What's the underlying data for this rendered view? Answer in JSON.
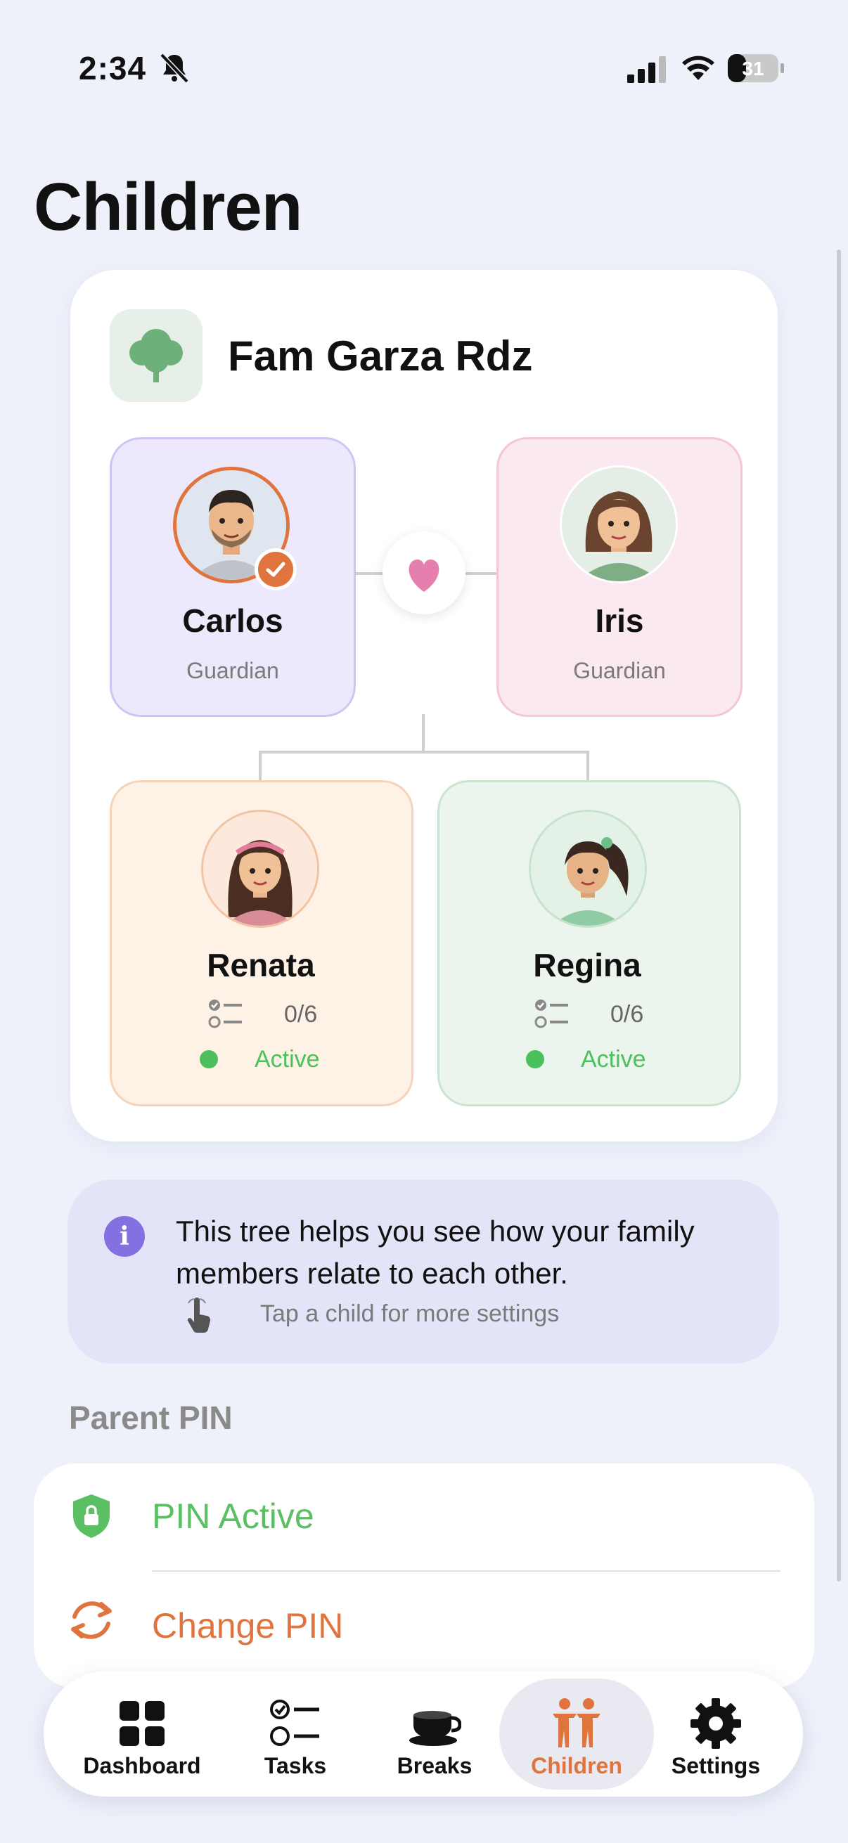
{
  "status_bar": {
    "time": "2:34",
    "battery": "31"
  },
  "page": {
    "title": "Children"
  },
  "family": {
    "name": "Fam Garza Rdz",
    "guardians": [
      {
        "name": "Carlos",
        "role": "Guardian",
        "selected": true
      },
      {
        "name": "Iris",
        "role": "Guardian"
      }
    ],
    "children": [
      {
        "name": "Renata",
        "tasks": "0/6",
        "status": "Active"
      },
      {
        "name": "Regina",
        "tasks": "0/6",
        "status": "Active"
      }
    ]
  },
  "info": {
    "text": "This tree helps you see how your family members relate to each other.",
    "hint": "Tap a child for more settings"
  },
  "parent_pin": {
    "section_label": "Parent PIN",
    "status": "PIN Active",
    "change_label": "Change PIN"
  },
  "tabbar": {
    "items": [
      {
        "label": "Dashboard",
        "icon": "grid-icon"
      },
      {
        "label": "Tasks",
        "icon": "checklist-icon"
      },
      {
        "label": "Breaks",
        "icon": "cup-icon"
      },
      {
        "label": "Children",
        "icon": "people-icon",
        "active": true
      },
      {
        "label": "Settings",
        "icon": "gear-icon"
      }
    ]
  },
  "colors": {
    "accent": "#e0743e",
    "active_green": "#4cc05a",
    "info_purple": "#8470e0",
    "background": "#eef1fa"
  }
}
